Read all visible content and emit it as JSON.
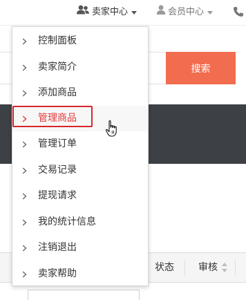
{
  "topbar": {
    "seller_center_label": "卖家中心",
    "member_center_label": "会员中心",
    "seller_icon": "users-icon",
    "member_icon": "user-icon",
    "phone_icon": "phone-icon"
  },
  "search": {
    "button_label": "搜索",
    "input_value": ""
  },
  "table": {
    "headers": {
      "status": "状态",
      "review": "审核"
    }
  },
  "dropdown": {
    "items": [
      {
        "label": "控制面板"
      },
      {
        "label": "卖家简介"
      },
      {
        "label": "添加商品"
      },
      {
        "label": "管理商品"
      },
      {
        "label": "管理订单"
      },
      {
        "label": "交易记录"
      },
      {
        "label": "提现请求"
      },
      {
        "label": "我的统计信息"
      },
      {
        "label": "注销退出"
      },
      {
        "label": "卖家帮助"
      }
    ],
    "active_item": "管理商品"
  },
  "colors": {
    "accent": "#f26c4f",
    "highlight": "#d6262b",
    "active_text": "#e4393c",
    "dark_band": "#3d4145"
  }
}
